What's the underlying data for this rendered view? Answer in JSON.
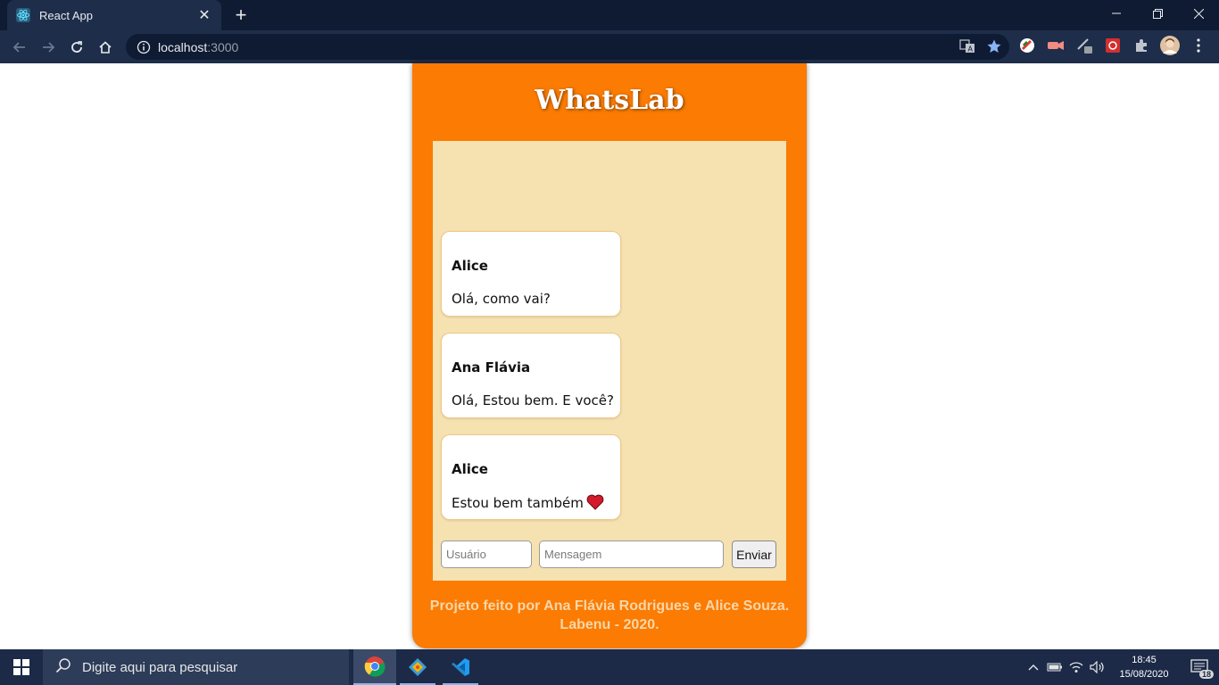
{
  "browser": {
    "tab_title": "React App",
    "url_host": "localhost",
    "url_port": ":3000"
  },
  "app": {
    "title": "WhatsLab",
    "messages": [
      {
        "user": "Alice",
        "text": "Olá, como vai?"
      },
      {
        "user": "Ana Flávia",
        "text": "Olá, Estou bem. E você?"
      },
      {
        "user": "Alice",
        "text": "Estou bem também"
      }
    ],
    "user_placeholder": "Usuário",
    "message_placeholder": "Mensagem",
    "send_label": "Enviar",
    "footer_line1": "Projeto feito por Ana Flávia Rodrigues e Alice Souza.",
    "footer_line2": "Labenu - 2020.",
    "colors": {
      "card": "#fb7b03",
      "chat_bg": "#f5e2b0",
      "footer_text": "#f9d6a7"
    }
  },
  "taskbar": {
    "search_placeholder": "Digite aqui para pesquisar",
    "time": "18:45",
    "date": "15/08/2020",
    "notification_count": "18"
  }
}
